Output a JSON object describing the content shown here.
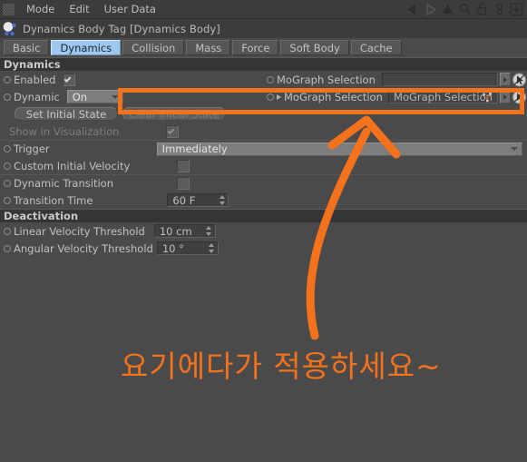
{
  "menubar": {
    "grip_icon": "dots-grip-icon",
    "items": [
      {
        "label": "Mode",
        "name": "menu-mode"
      },
      {
        "label": "Edit",
        "name": "menu-edit"
      },
      {
        "label": "User Data",
        "name": "menu-user-data"
      }
    ],
    "right_icons": [
      {
        "name": "back-arrow-icon"
      },
      {
        "name": "forward-arrow-icon"
      },
      {
        "name": "up-arrow-icon"
      },
      {
        "name": "search-icon"
      },
      {
        "name": "lock-open-icon"
      },
      {
        "name": "link-chain-icon"
      },
      {
        "name": "add-plus-icon"
      }
    ]
  },
  "object": {
    "icon": "dynamics-body-tag-icon",
    "title": "Dynamics Body Tag [Dynamics Body]"
  },
  "tabs": [
    {
      "label": "Basic",
      "active": false
    },
    {
      "label": "Dynamics",
      "active": true
    },
    {
      "label": "Collision",
      "active": false
    },
    {
      "label": "Mass",
      "active": false
    },
    {
      "label": "Force",
      "active": false
    },
    {
      "label": "Soft Body",
      "active": false
    },
    {
      "label": "Cache",
      "active": false
    }
  ],
  "dynamics": {
    "header": "Dynamics",
    "enabled": {
      "label": "Enabled",
      "checked": true
    },
    "mograph_selection_top": {
      "label": "MoGraph Selection",
      "value": ""
    },
    "dynamic": {
      "label": "Dynamic",
      "value": "On"
    },
    "mograph_selection_linked": {
      "label": "MoGraph Selection",
      "value": "MoGraph Selection"
    },
    "set_initial_state": "Set Initial State",
    "clear_initial_state": "Clear Initial State",
    "show_in_visualization": {
      "label": "Show in Visualization",
      "checked": true
    },
    "trigger": {
      "label": "Trigger",
      "value": "Immediately"
    },
    "custom_initial_velocity": {
      "label": "Custom Initial Velocity",
      "checked": false
    },
    "dynamic_transition": {
      "label": "Dynamic Transition",
      "checked": false
    },
    "transition_time": {
      "label": "Transition Time",
      "value": "60 F"
    }
  },
  "deactivation": {
    "header": "Deactivation",
    "linear_velocity_threshold": {
      "label": "Linear Velocity Threshold",
      "value": "10 cm"
    },
    "angular_velocity_threshold": {
      "label": "Angular Velocity Threshold",
      "value": "10 °"
    }
  },
  "annotation": {
    "text": "요기에다가 적용하세요~",
    "color": "#f4721b",
    "highlight_name": "highlight-rectangle",
    "arrow_name": "curved-arrow-pointer"
  },
  "colors": {
    "accent_orange": "#f4721b",
    "panel_bg": "#4a4a4a",
    "header_bg": "#353535",
    "tab_active": "#9ec8f0"
  }
}
